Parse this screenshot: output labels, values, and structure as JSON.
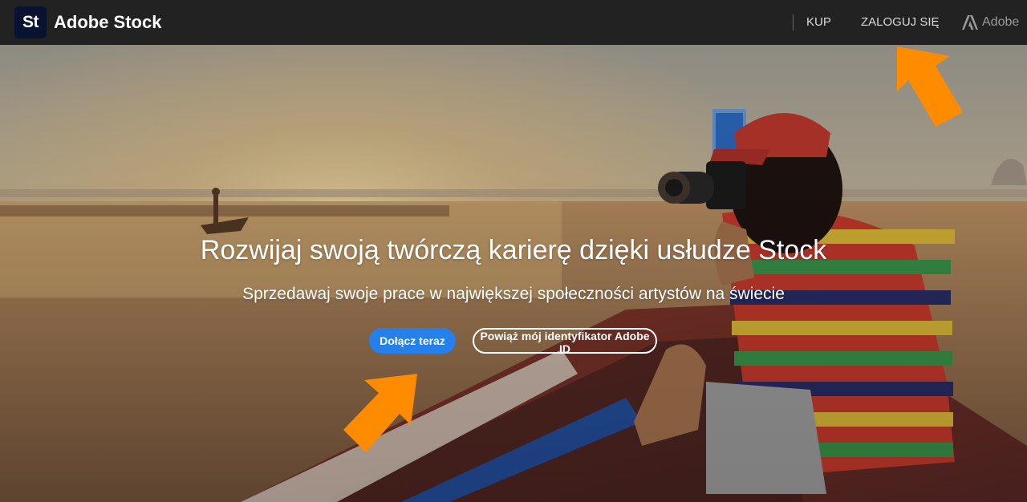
{
  "header": {
    "logo_badge": "St",
    "brand_name": "Adobe Stock",
    "nav": {
      "buy_label": "KUP",
      "login_label": "ZALOGUJ SIĘ",
      "adobe_label": "Adobe"
    }
  },
  "hero": {
    "title": "Rozwijaj swoją twórczą karierę dzięki usłudze Stock",
    "subtitle": "Sprzedawaj swoje prace w największej społeczności artystów na świecie",
    "join_button_label": "Dołącz teraz",
    "link_adobe_id_button_label": "Powiąż mój identyfikator Adobe ID"
  },
  "colors": {
    "header_bg": "#222222",
    "logo_badge_bg": "#071330",
    "primary_button": "#2680eb",
    "annotation_arrow": "#ff8c00"
  },
  "icons": {
    "adobe_logo": "adobe-logo-icon",
    "annotation": "arrow-annotation-icon"
  }
}
